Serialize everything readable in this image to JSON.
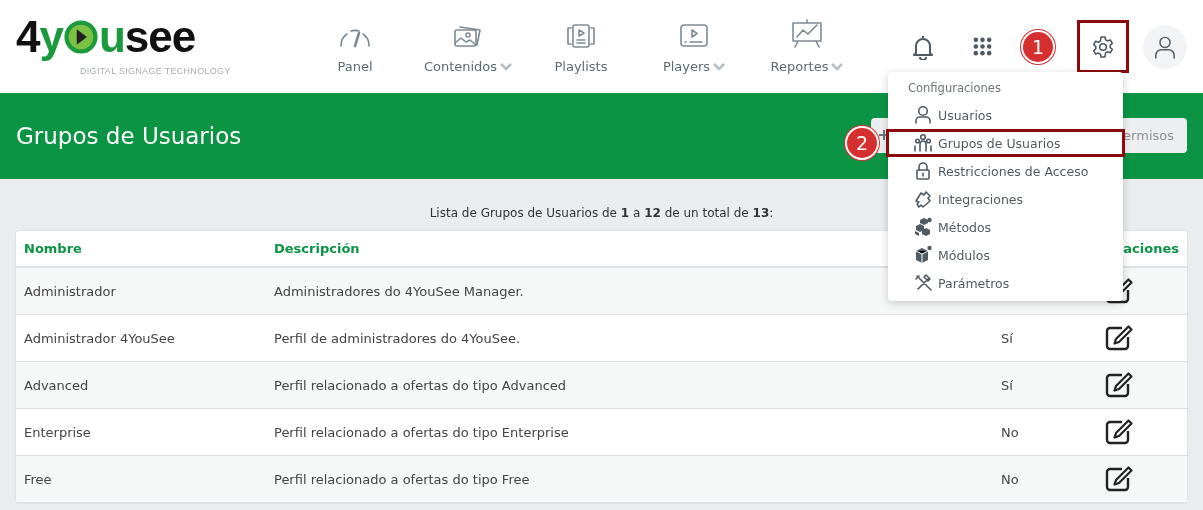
{
  "logo": {
    "parts": [
      {
        "kind": "dark",
        "text": "4"
      },
      {
        "kind": "green",
        "text": "y"
      },
      {
        "kind": "play"
      },
      {
        "kind": "green",
        "text": "u"
      },
      {
        "kind": "dark",
        "text": "see"
      }
    ],
    "tagline": "DIGITAL SIGNAGE TECHNOLOGY"
  },
  "nav": [
    {
      "label": "Panel",
      "dropdown": false
    },
    {
      "label": "Contenidos",
      "dropdown": true
    },
    {
      "label": "Playlists",
      "dropdown": false
    },
    {
      "label": "Players",
      "dropdown": true
    },
    {
      "label": "Reportes",
      "dropdown": true
    }
  ],
  "actions": [
    {
      "kind": "bell"
    },
    {
      "kind": "apps"
    },
    {
      "kind": "callout",
      "text": "1"
    },
    {
      "kind": "settings",
      "highlighted": true
    },
    {
      "kind": "user"
    }
  ],
  "page_title": "Grupos de Usuarios",
  "header_button": {
    "label": "ermisos"
  },
  "summary": "Lista de Grupos de Usuarios de **1** a **12** de un total de **13**:",
  "table": {
    "columns": [
      {
        "label": "Nombre"
      },
      {
        "label": "Descripción"
      },
      {
        "label": "aciones"
      }
    ],
    "rows": [
      {
        "name": "Administrador",
        "description": "Administradores do 4YouSee Manager."
      },
      {
        "name": "Administrador 4YouSee",
        "description": "Perfil de administradores do 4YouSee.",
        "column_3": "Sí"
      },
      {
        "name": "Advanced",
        "description": "Perfil relacionado a ofertas do tipo Advanced",
        "column_3": "Sí"
      },
      {
        "name": "Enterprise",
        "description": "Perfil relacionado a ofertas do tipo Enterprise",
        "column_3": "No"
      },
      {
        "name": "Free",
        "description": "Perfil relacionado a ofertas do tipo Free",
        "column_3": "No"
      }
    ]
  },
  "settings_menu": {
    "title": "Configuraciones",
    "items": [
      {
        "label": "Usuarios",
        "highlighted": false
      },
      {
        "label": "Grupos de Usuarios",
        "highlighted": true,
        "callout": "2"
      },
      {
        "label": "Restricciones de Acceso",
        "highlighted": false
      },
      {
        "label": "Integraciones",
        "highlighted": false
      },
      {
        "label": "Métodos",
        "highlighted": false
      },
      {
        "label": "Módulos",
        "highlighted": false
      },
      {
        "label": "Parámetros",
        "highlighted": false
      }
    ]
  }
}
